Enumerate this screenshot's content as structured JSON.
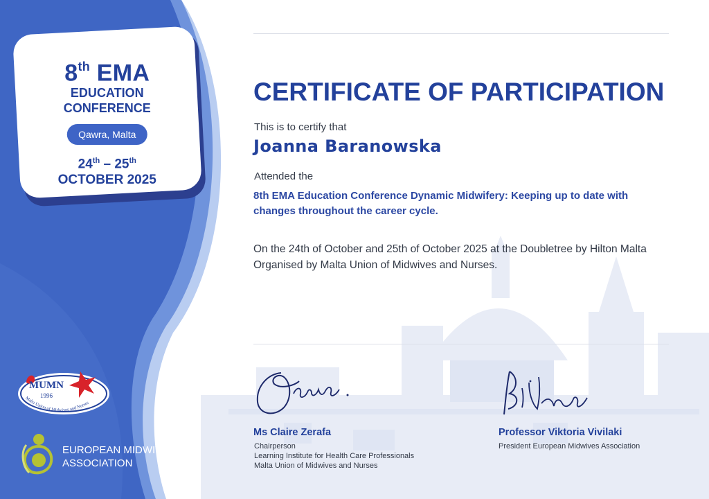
{
  "badge": {
    "edition": "8",
    "edition_suffix": "th",
    "name": "EMA",
    "line1": "EDUCATION",
    "line2": "CONFERENCE",
    "location": "Qawra, Malta",
    "day_start": "24",
    "day_start_suffix": "th",
    "dash": " – ",
    "day_end": "25",
    "day_end_suffix": "th",
    "month_year": "OCTOBER 2025"
  },
  "logos": {
    "mumn_text": "MUMN",
    "mumn_year": "1996",
    "mumn_ring_text": "Malta Union of Midwives and Nurses",
    "ema_line1": "EUROPEAN MIDWIVES",
    "ema_line2": "ASSOCIATION"
  },
  "certificate": {
    "title": "CERTIFICATE OF PARTICIPATION",
    "certify_text": "This is to certify that",
    "recipient": "Joanna Baranowska",
    "attended_text": "Attended the",
    "event": "8th EMA Education Conference Dynamic Midwifery: Keeping up to date with changes throughout the career cycle.",
    "details": "On the 24th of October and 25th of October 2025 at the Doubletree by Hilton Malta Organised by Malta Union of Midwives and Nurses."
  },
  "signatories": [
    {
      "name": "Ms Claire Zerafa",
      "role_line1": "Chairperson",
      "role_line2": "Learning Institute for Health Care Professionals",
      "role_line3": "Malta Union of Midwives and Nurses"
    },
    {
      "name": "Professor Viktoria Vivilaki",
      "role_line1": "President European Midwives Association"
    }
  ],
  "colors": {
    "primary_blue": "#23419b",
    "panel_blue": "#3f66c4",
    "panel_light": "#6f93dc",
    "mumn_red": "#d8232a",
    "ema_green": "#b5c234"
  }
}
